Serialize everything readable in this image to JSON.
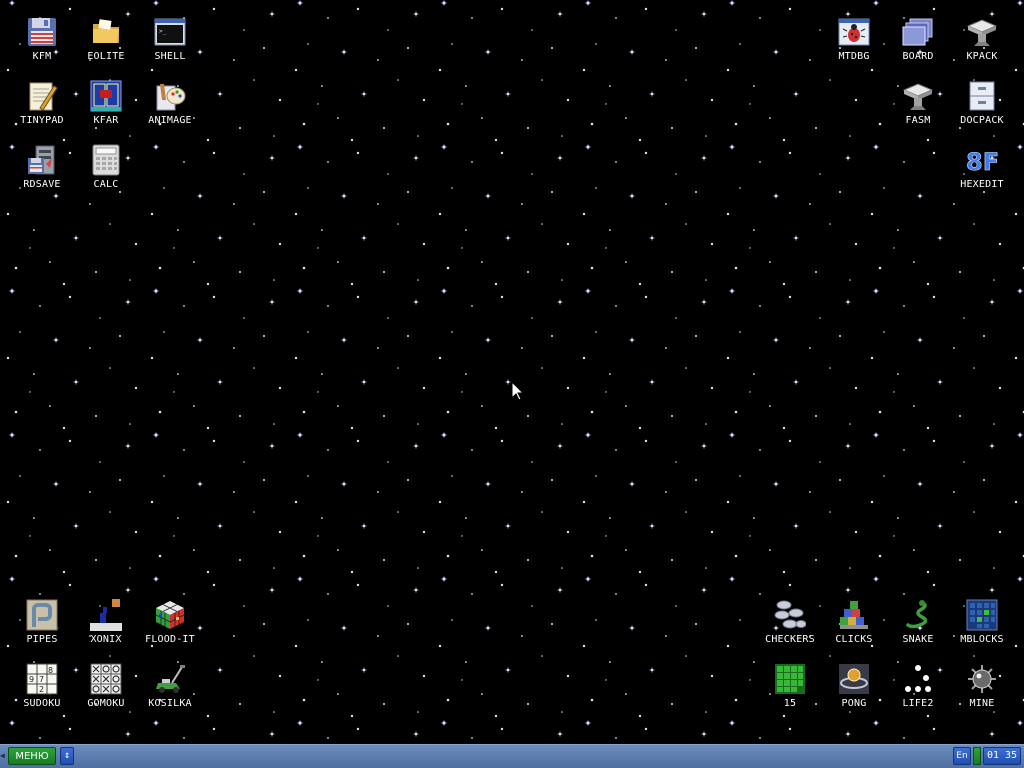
{
  "desktop": {
    "background_color": "#000000",
    "star_color": "#cfe2ff",
    "icons": [
      {
        "id": "kfm",
        "label": "KFM",
        "icon": "floppy-disk-icon"
      },
      {
        "id": "eolite",
        "label": "EOLITE",
        "icon": "folder-icon"
      },
      {
        "id": "shell",
        "label": "SHELL",
        "icon": "terminal-icon"
      },
      {
        "id": "tinypad",
        "label": "TINYPAD",
        "icon": "notepad-icon"
      },
      {
        "id": "kfar",
        "label": "KFAR",
        "icon": "file-manager-icon"
      },
      {
        "id": "animage",
        "label": "ANIMAGE",
        "icon": "paint-icon"
      },
      {
        "id": "rdsave",
        "label": "RDSAVE",
        "icon": "save-ramdisk-icon"
      },
      {
        "id": "calc",
        "label": "CALC",
        "icon": "calculator-icon"
      },
      {
        "id": "mtdbg",
        "label": "MTDBG",
        "icon": "debugger-bug-icon"
      },
      {
        "id": "board",
        "label": "BOARD",
        "icon": "board-windows-icon"
      },
      {
        "id": "kpack",
        "label": "KPACK",
        "icon": "anvil-icon"
      },
      {
        "id": "fasm",
        "label": "FASM",
        "icon": "anvil-icon"
      },
      {
        "id": "docpack",
        "label": "DOCPACK",
        "icon": "drawer-cabinet-icon"
      },
      {
        "id": "hexedit",
        "label": "HEXEDIT",
        "icon": "hex-8f-icon"
      },
      {
        "id": "pipes",
        "label": "PIPES",
        "icon": "pipes-icon"
      },
      {
        "id": "xonix",
        "label": "XONIX",
        "icon": "xonix-icon"
      },
      {
        "id": "flood-it",
        "label": "FLOOD-IT",
        "icon": "rubiks-cube-icon"
      },
      {
        "id": "sudoku",
        "label": "SUDOKU",
        "icon": "sudoku-grid-icon"
      },
      {
        "id": "gomoku",
        "label": "GOMOKU",
        "icon": "gomoku-board-icon"
      },
      {
        "id": "kosilka",
        "label": "KOSILKA",
        "icon": "lawnmower-icon"
      },
      {
        "id": "checkers",
        "label": "CHECKERS",
        "icon": "checkers-pieces-icon"
      },
      {
        "id": "clicks",
        "label": "CLICKS",
        "icon": "colored-blocks-icon"
      },
      {
        "id": "snake",
        "label": "SNAKE",
        "icon": "snake-icon"
      },
      {
        "id": "mblocks",
        "label": "MBLOCKS",
        "icon": "blue-grid-icon"
      },
      {
        "id": "fifteen",
        "label": "15",
        "icon": "green-tiles-icon"
      },
      {
        "id": "pong",
        "label": "PONG",
        "icon": "pong-icon"
      },
      {
        "id": "life2",
        "label": "LIFE2",
        "icon": "life-dots-icon"
      },
      {
        "id": "mine",
        "label": "MINE",
        "icon": "mine-icon"
      }
    ]
  },
  "taskbar": {
    "menu_label": "МЕНЮ",
    "scroll_glyph": "↕",
    "language": "En",
    "clock": "01 35",
    "colors": {
      "bar": "#5b7bb0",
      "menu_button": "#1f8f2b",
      "tray_button": "#2a5bc0"
    }
  }
}
